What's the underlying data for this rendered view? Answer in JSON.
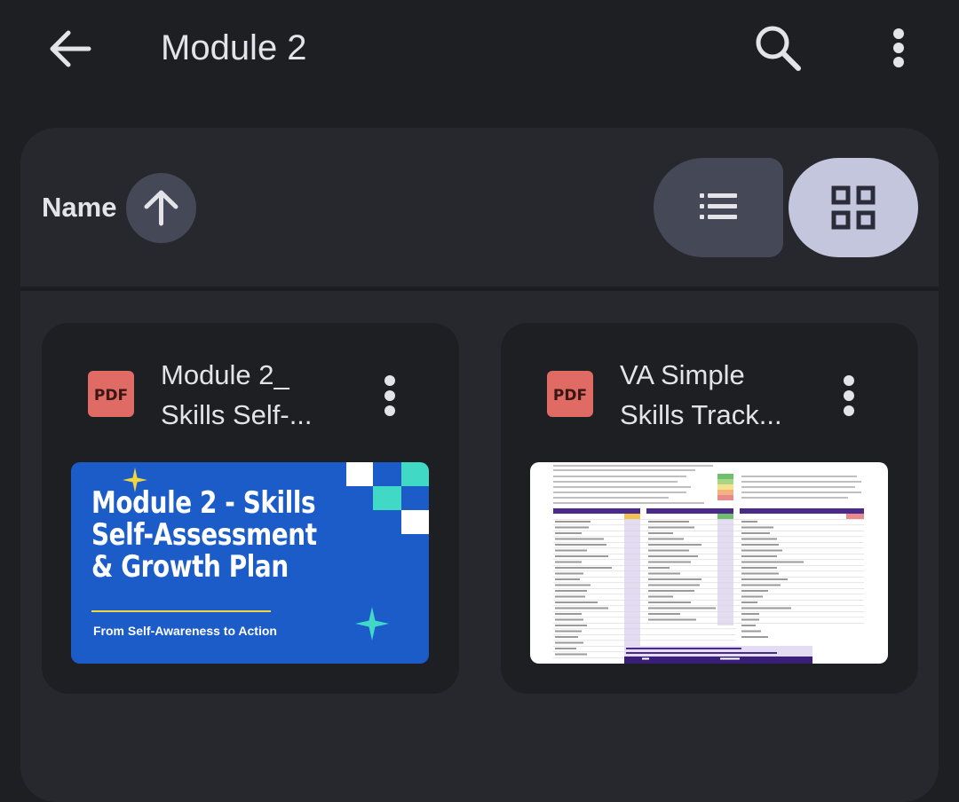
{
  "header": {
    "title": "Module 2"
  },
  "sort": {
    "label": "Name",
    "direction": "ascending"
  },
  "view": {
    "selected": "grid"
  },
  "files": [
    {
      "name_line1": "Module 2_",
      "name_line2": "Skills Self-...",
      "type_badge": "PDF",
      "thumbnail": {
        "title": "Module 2 - Skills Self-Assessment & Growth Plan",
        "subtitle": "From Self-Awareness to Action"
      }
    },
    {
      "name_line1": "VA Simple",
      "name_line2": "Skills Track...",
      "type_badge": "PDF"
    }
  ],
  "colors": {
    "background": "#1e1f23",
    "panel": "#27282d",
    "pdf_badge": "#e06a64",
    "selected_toggle": "#c4c6dd",
    "unselected_toggle": "#454857",
    "thumbnail_blue": "#1b5cc9"
  },
  "icons": {
    "back": "arrow-left-icon",
    "search": "search-icon",
    "more": "more-vert-icon",
    "sort": "arrow-up-icon",
    "list_view": "list-view-icon",
    "grid_view": "grid-view-icon"
  }
}
